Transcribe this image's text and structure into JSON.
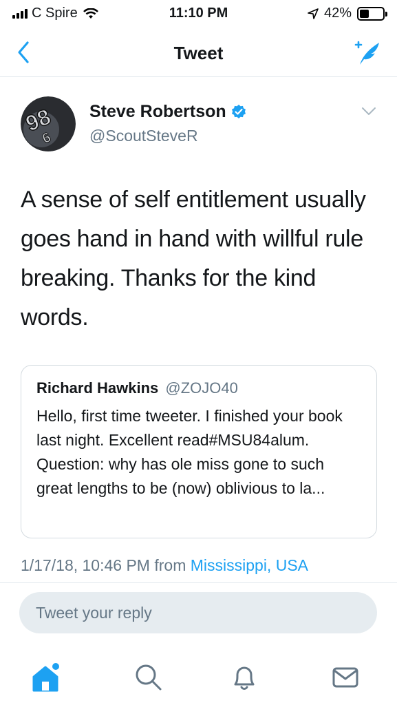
{
  "status_bar": {
    "carrier": "C Spire",
    "time": "11:10 PM",
    "battery": "42%",
    "battery_level": 0.42,
    "icons": [
      "signal-icon",
      "wifi-icon",
      "location-icon",
      "battery-icon"
    ]
  },
  "nav": {
    "title": "Tweet",
    "back_icon": "chevron-left-icon",
    "compose_icon": "compose-tweet-icon"
  },
  "tweet": {
    "author_name": "Steve Robertson",
    "author_handle": "@ScoutSteveR",
    "verified": true,
    "text": "A sense of self entitlement usually goes hand in hand with willful rule breaking. Thanks for the kind words.",
    "quoted": {
      "name": "Richard Hawkins",
      "handle": "@ZOJO40",
      "text": "Hello, first time tweeter. I finished your book last night. Excellent read#MSU84alum. Question: why has ole miss gone to such great lengths to be (now) oblivious to la..."
    },
    "timestamp": "1/17/18, 10:46 PM from",
    "location": "Mississippi, USA"
  },
  "reply": {
    "placeholder": "Tweet your reply"
  },
  "tab_bar": {
    "items": [
      "home-icon",
      "search-icon",
      "notifications-icon",
      "messages-icon"
    ]
  },
  "colors": {
    "accent": "#1da1f2",
    "secondary_text": "#657786",
    "reply_bg": "#e6ecf0"
  }
}
